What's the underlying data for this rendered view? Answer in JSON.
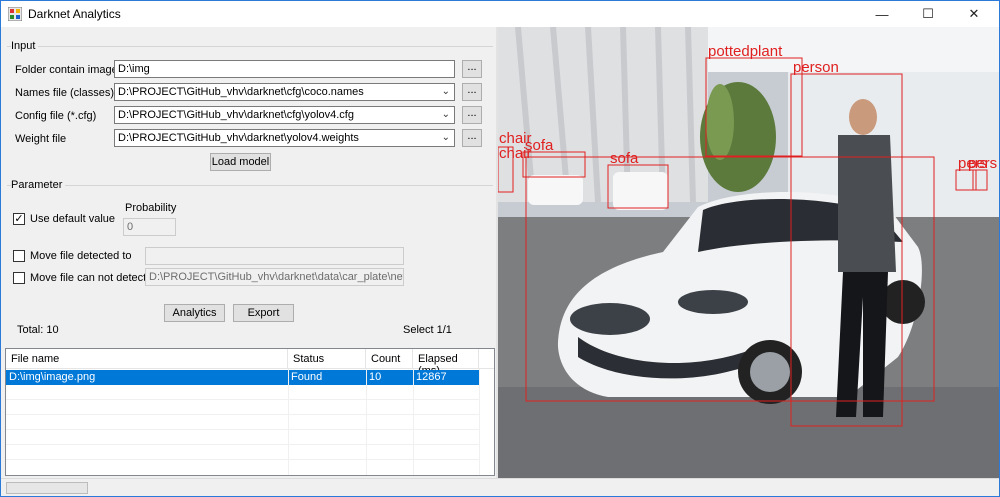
{
  "window": {
    "title": "Darknet Analytics",
    "min_glyph": "—",
    "max_glyph": "☐",
    "close_glyph": "✕"
  },
  "input": {
    "group_label": "Input",
    "folder": {
      "label": "Folder contain images",
      "value": "D:\\img",
      "browse": "..."
    },
    "names": {
      "label": "Names file (classes)",
      "value": "D:\\PROJECT\\GitHub_vhv\\darknet\\cfg\\coco.names",
      "browse": "..."
    },
    "config": {
      "label": "Config file (*.cfg)",
      "value": "D:\\PROJECT\\GitHub_vhv\\darknet\\cfg\\yolov4.cfg",
      "browse": "..."
    },
    "weight": {
      "label": "Weight file",
      "value": "D:\\PROJECT\\GitHub_vhv\\darknet\\yolov4.weights",
      "browse": "..."
    },
    "load_button": "Load model"
  },
  "parameter": {
    "group_label": "Parameter",
    "use_default": {
      "label": "Use default value",
      "checked": "✓"
    },
    "probability": {
      "label": "Probability",
      "value": "0"
    },
    "move_detected": {
      "label": "Move file detected to",
      "value": ""
    },
    "move_not_detected": {
      "label": "Move file can not detect to",
      "value": "D:\\PROJECT\\GitHub_vhv\\darknet\\data\\car_plate\\new"
    }
  },
  "actions": {
    "analytics": "Analytics",
    "export": "Export"
  },
  "summary": {
    "total": "Total: 10",
    "select": "Select 1/1"
  },
  "table": {
    "columns": [
      "File name",
      "Status",
      "Count",
      "Elapsed (ms)"
    ],
    "rows": [
      {
        "file": "D:\\img\\image.png",
        "status": "Found",
        "count": "10",
        "elapsed": "12867"
      }
    ]
  },
  "detections": {
    "box_color": "#e02020",
    "labels": {
      "pottedplant": "pottedplant",
      "person": "person",
      "sofa": "sofa",
      "chair1": "chair",
      "chair2": "chair",
      "sofa2": "sofa",
      "person2": "pers",
      "person3": "pers"
    }
  },
  "colors": {
    "accent": "#0078d7",
    "window_border": "#2b79d8"
  }
}
